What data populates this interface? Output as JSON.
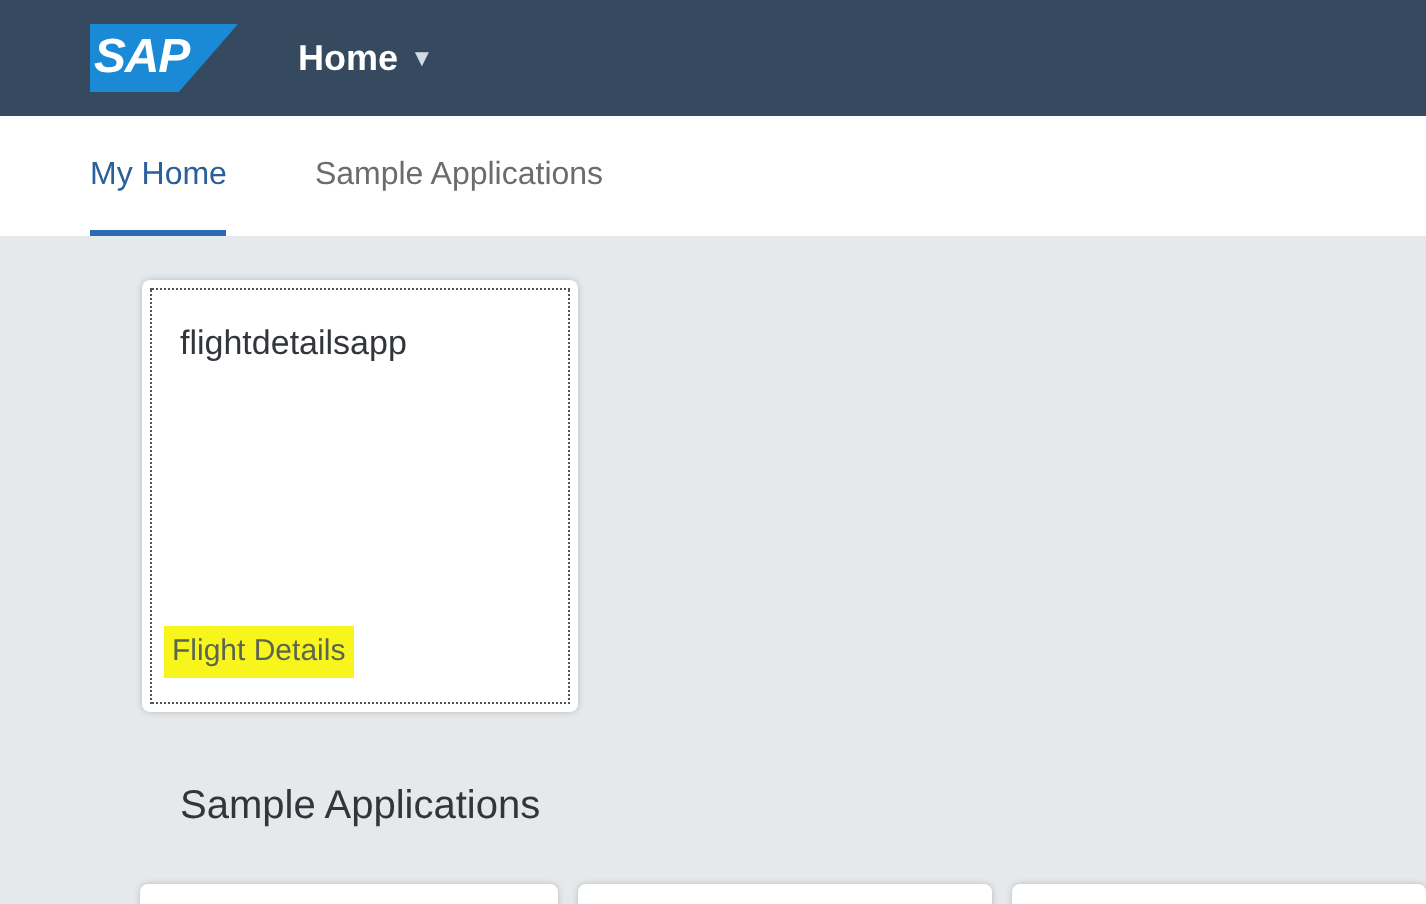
{
  "header": {
    "logo": "SAP",
    "title": "Home",
    "menu_caret": "▼"
  },
  "tabs": [
    {
      "label": "My Home",
      "selected": true
    },
    {
      "label": "Sample Applications",
      "selected": false
    }
  ],
  "tiles": [
    {
      "title": "flightdetailsapp",
      "subtitle": "Flight Details",
      "subtitle_highlighted": true
    }
  ],
  "sections": [
    {
      "title": "Sample Applications"
    }
  ]
}
